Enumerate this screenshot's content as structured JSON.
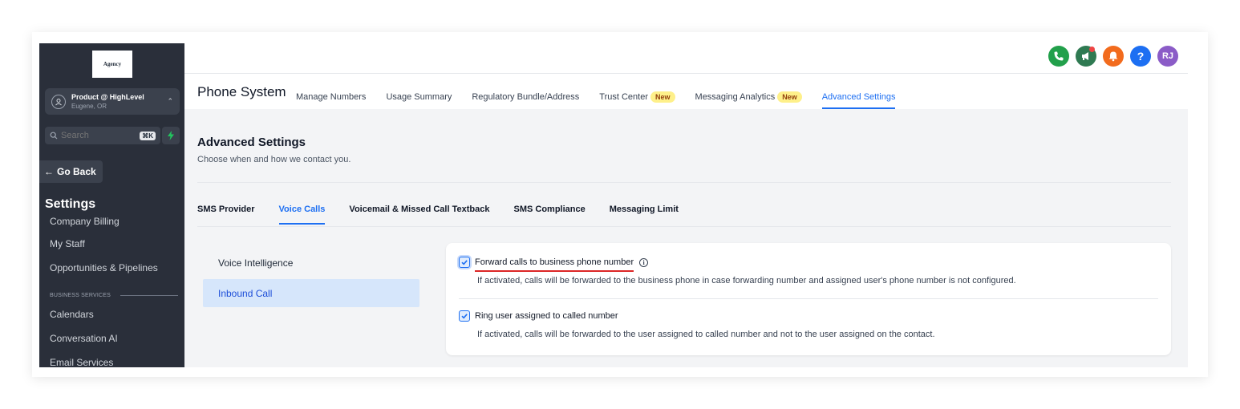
{
  "sidebar": {
    "logo_text": "Agency",
    "account": {
      "name": "Product @ HighLevel",
      "location": "Eugene, OR"
    },
    "search": {
      "placeholder": "Search",
      "shortcut": "⌘K"
    },
    "go_back": "Go Back",
    "settings_title": "Settings",
    "nav": {
      "company_billing": "Company Billing",
      "my_staff": "My Staff",
      "opportunities": "Opportunities & Pipelines",
      "section_business": "BUSINESS SERVICES",
      "calendars": "Calendars",
      "conversation_ai": "Conversation AI",
      "email_services": "Email Services"
    }
  },
  "header": {
    "avatar_initials": "RJ",
    "page_title": "Phone System",
    "tabs": {
      "manage_numbers": "Manage Numbers",
      "usage_summary": "Usage Summary",
      "regulatory": "Regulatory Bundle/Address",
      "trust_center": "Trust Center",
      "messaging_analytics": "Messaging Analytics",
      "advanced_settings": "Advanced Settings"
    },
    "new_badge": "New",
    "icon_colors": {
      "phone": "#22a04b",
      "announce": "#2f7a52",
      "bell": "#f26b1d",
      "help": "#1d6ff2",
      "avatar": "#8b5cc7"
    }
  },
  "content": {
    "title": "Advanced Settings",
    "subtitle": "Choose when and how we contact you.",
    "subtabs": {
      "sms_provider": "SMS Provider",
      "voice_calls": "Voice Calls",
      "voicemail": "Voicemail & Missed Call Textback",
      "sms_compliance": "SMS Compliance",
      "messaging_limit": "Messaging Limit"
    },
    "left_menu": {
      "voice_intelligence": "Voice Intelligence",
      "inbound_call": "Inbound Call"
    },
    "options": {
      "forward": {
        "label": "Forward calls to business phone number",
        "description": "If activated, calls will be forwarded to the business phone in case forwarding number and assigned user's phone number is not configured.",
        "checked": true
      },
      "ring_user": {
        "label": "Ring user assigned to called number",
        "description": "If activated, calls will be forwarded to the user assigned to called number and not to the user assigned on the contact.",
        "checked": true
      }
    }
  }
}
